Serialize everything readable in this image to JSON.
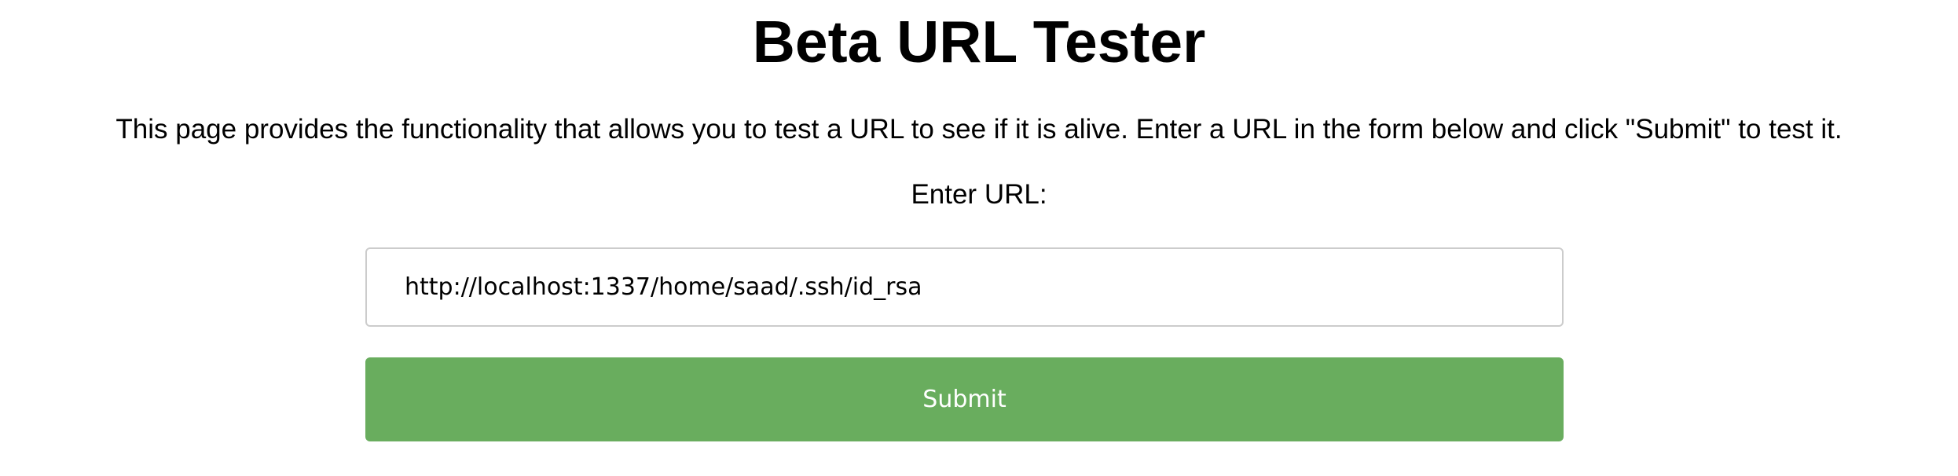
{
  "page": {
    "title": "Beta URL Tester",
    "description": "This page provides the functionality that allows you to test a URL to see if it is alive. Enter a URL in the form below and click \"Submit\" to test it."
  },
  "form": {
    "url_label": "Enter URL:",
    "url_value": "http://localhost:1337/home/saad/.ssh/id_rsa",
    "submit_label": "Submit"
  },
  "colors": {
    "background": "#ffffff",
    "text": "#000000",
    "submit_button": "#69ad5e",
    "submit_text": "#ffffff",
    "input_border": "#cccccc"
  }
}
